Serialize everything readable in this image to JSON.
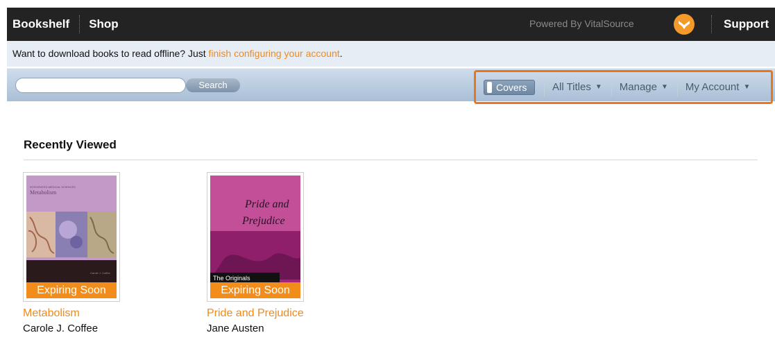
{
  "topbar": {
    "bookshelf": "Bookshelf",
    "shop": "Shop",
    "powered_by": "Powered By VitalSource",
    "support": "Support"
  },
  "notice": {
    "text": "Want to download books to read offline? Just ",
    "link": "finish configuring your account",
    "end": "."
  },
  "toolbar": {
    "search_value": "",
    "search_button": "Search",
    "covers": "Covers",
    "all_titles": "All Titles",
    "manage": "Manage",
    "my_account": "My Account",
    "highlight_color": "#e8761f"
  },
  "recently_viewed": {
    "heading": "Recently Viewed",
    "books": [
      {
        "title": "Metabolism",
        "author": "Carole J. Coffee",
        "badge": "Expiring Soon",
        "cover_series": "INTEGRATED MEDICAL SCIENCES",
        "cover_title": "Metabolism",
        "cover_author": "Carole J. Coffee"
      },
      {
        "title": "Pride and Prejudice",
        "author": "Jane Austen",
        "badge": "Expiring Soon",
        "cover_title_1": "Pride and",
        "cover_title_2": "Prejudice",
        "cover_series": "The Originals"
      }
    ]
  }
}
